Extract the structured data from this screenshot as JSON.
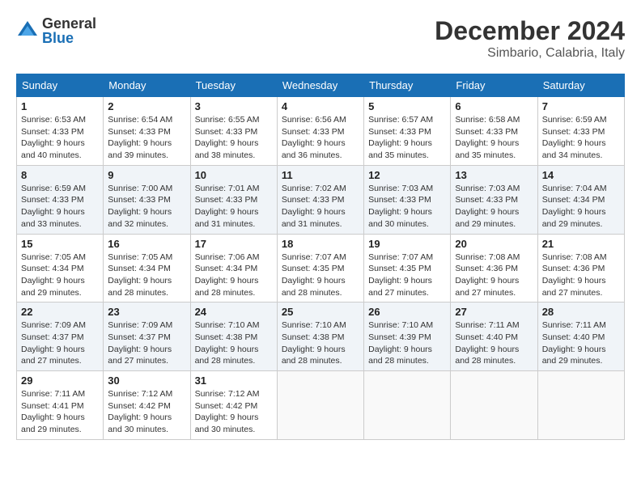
{
  "header": {
    "logo_general": "General",
    "logo_blue": "Blue",
    "month_title": "December 2024",
    "location": "Simbario, Calabria, Italy"
  },
  "days_of_week": [
    "Sunday",
    "Monday",
    "Tuesday",
    "Wednesday",
    "Thursday",
    "Friday",
    "Saturday"
  ],
  "weeks": [
    [
      {
        "day": "1",
        "sunrise": "6:53 AM",
        "sunset": "4:33 PM",
        "daylight": "9 hours and 40 minutes."
      },
      {
        "day": "2",
        "sunrise": "6:54 AM",
        "sunset": "4:33 PM",
        "daylight": "9 hours and 39 minutes."
      },
      {
        "day": "3",
        "sunrise": "6:55 AM",
        "sunset": "4:33 PM",
        "daylight": "9 hours and 38 minutes."
      },
      {
        "day": "4",
        "sunrise": "6:56 AM",
        "sunset": "4:33 PM",
        "daylight": "9 hours and 36 minutes."
      },
      {
        "day": "5",
        "sunrise": "6:57 AM",
        "sunset": "4:33 PM",
        "daylight": "9 hours and 35 minutes."
      },
      {
        "day": "6",
        "sunrise": "6:58 AM",
        "sunset": "4:33 PM",
        "daylight": "9 hours and 35 minutes."
      },
      {
        "day": "7",
        "sunrise": "6:59 AM",
        "sunset": "4:33 PM",
        "daylight": "9 hours and 34 minutes."
      }
    ],
    [
      {
        "day": "8",
        "sunrise": "6:59 AM",
        "sunset": "4:33 PM",
        "daylight": "9 hours and 33 minutes."
      },
      {
        "day": "9",
        "sunrise": "7:00 AM",
        "sunset": "4:33 PM",
        "daylight": "9 hours and 32 minutes."
      },
      {
        "day": "10",
        "sunrise": "7:01 AM",
        "sunset": "4:33 PM",
        "daylight": "9 hours and 31 minutes."
      },
      {
        "day": "11",
        "sunrise": "7:02 AM",
        "sunset": "4:33 PM",
        "daylight": "9 hours and 31 minutes."
      },
      {
        "day": "12",
        "sunrise": "7:03 AM",
        "sunset": "4:33 PM",
        "daylight": "9 hours and 30 minutes."
      },
      {
        "day": "13",
        "sunrise": "7:03 AM",
        "sunset": "4:33 PM",
        "daylight": "9 hours and 29 minutes."
      },
      {
        "day": "14",
        "sunrise": "7:04 AM",
        "sunset": "4:34 PM",
        "daylight": "9 hours and 29 minutes."
      }
    ],
    [
      {
        "day": "15",
        "sunrise": "7:05 AM",
        "sunset": "4:34 PM",
        "daylight": "9 hours and 29 minutes."
      },
      {
        "day": "16",
        "sunrise": "7:05 AM",
        "sunset": "4:34 PM",
        "daylight": "9 hours and 28 minutes."
      },
      {
        "day": "17",
        "sunrise": "7:06 AM",
        "sunset": "4:34 PM",
        "daylight": "9 hours and 28 minutes."
      },
      {
        "day": "18",
        "sunrise": "7:07 AM",
        "sunset": "4:35 PM",
        "daylight": "9 hours and 28 minutes."
      },
      {
        "day": "19",
        "sunrise": "7:07 AM",
        "sunset": "4:35 PM",
        "daylight": "9 hours and 27 minutes."
      },
      {
        "day": "20",
        "sunrise": "7:08 AM",
        "sunset": "4:36 PM",
        "daylight": "9 hours and 27 minutes."
      },
      {
        "day": "21",
        "sunrise": "7:08 AM",
        "sunset": "4:36 PM",
        "daylight": "9 hours and 27 minutes."
      }
    ],
    [
      {
        "day": "22",
        "sunrise": "7:09 AM",
        "sunset": "4:37 PM",
        "daylight": "9 hours and 27 minutes."
      },
      {
        "day": "23",
        "sunrise": "7:09 AM",
        "sunset": "4:37 PM",
        "daylight": "9 hours and 27 minutes."
      },
      {
        "day": "24",
        "sunrise": "7:10 AM",
        "sunset": "4:38 PM",
        "daylight": "9 hours and 28 minutes."
      },
      {
        "day": "25",
        "sunrise": "7:10 AM",
        "sunset": "4:38 PM",
        "daylight": "9 hours and 28 minutes."
      },
      {
        "day": "26",
        "sunrise": "7:10 AM",
        "sunset": "4:39 PM",
        "daylight": "9 hours and 28 minutes."
      },
      {
        "day": "27",
        "sunrise": "7:11 AM",
        "sunset": "4:40 PM",
        "daylight": "9 hours and 28 minutes."
      },
      {
        "day": "28",
        "sunrise": "7:11 AM",
        "sunset": "4:40 PM",
        "daylight": "9 hours and 29 minutes."
      }
    ],
    [
      {
        "day": "29",
        "sunrise": "7:11 AM",
        "sunset": "4:41 PM",
        "daylight": "9 hours and 29 minutes."
      },
      {
        "day": "30",
        "sunrise": "7:12 AM",
        "sunset": "4:42 PM",
        "daylight": "9 hours and 30 minutes."
      },
      {
        "day": "31",
        "sunrise": "7:12 AM",
        "sunset": "4:42 PM",
        "daylight": "9 hours and 30 minutes."
      },
      null,
      null,
      null,
      null
    ]
  ],
  "labels": {
    "sunrise": "Sunrise:",
    "sunset": "Sunset:",
    "daylight": "Daylight:"
  }
}
